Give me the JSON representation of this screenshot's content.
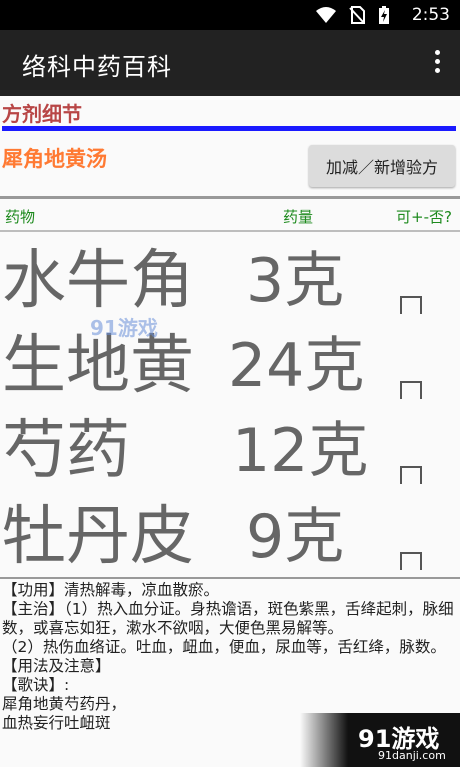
{
  "status_bar": {
    "time": "2:53",
    "icons": [
      "wifi-icon",
      "no-sim-icon",
      "battery-charging-icon"
    ]
  },
  "app_bar": {
    "title": "络科中药百科",
    "menu_icon": "more-vert-icon"
  },
  "section": {
    "title": "方剂细节"
  },
  "recipe": {
    "name": "犀角地黄汤",
    "add_button_label": "加减／新增验方"
  },
  "table": {
    "headers": {
      "herb": "药物",
      "dose": "药量",
      "option": "可+-否?"
    },
    "rows": [
      {
        "herb": "水牛角",
        "dose": "3克"
      },
      {
        "herb": "生地黄",
        "dose": "24克"
      },
      {
        "herb": "芍药",
        "dose": "12克"
      },
      {
        "herb": "牡丹皮",
        "dose": "9克"
      }
    ]
  },
  "details": {
    "line1": "【功用】清热解毒，凉血散瘀。",
    "line2": "【主治】（1）热入血分证。身热谵语，斑色紫黑，舌绛起刺，脉细数，或喜忘如狂，漱水不欲咽，大便色黑易解等。",
    "line3": "（2）热伤血络证。吐血，衄血，便血，尿血等，舌红绛，脉数。",
    "line4": "【用法及注意】",
    "line5": "【歌诀】:",
    "line6": "犀角地黄芍药丹，",
    "line7": "血热妄行吐衄斑"
  },
  "watermarks": {
    "middle": "91游戏",
    "bottom": "91游戏",
    "bottom_url": "91danji.com"
  },
  "colors": {
    "app_bar": "#222222",
    "section_title": "#b84646",
    "blue_rule": "#1a1aff",
    "recipe_name": "#ff7a33",
    "table_header": "#1d8a1d",
    "herb_text": "#666666"
  }
}
